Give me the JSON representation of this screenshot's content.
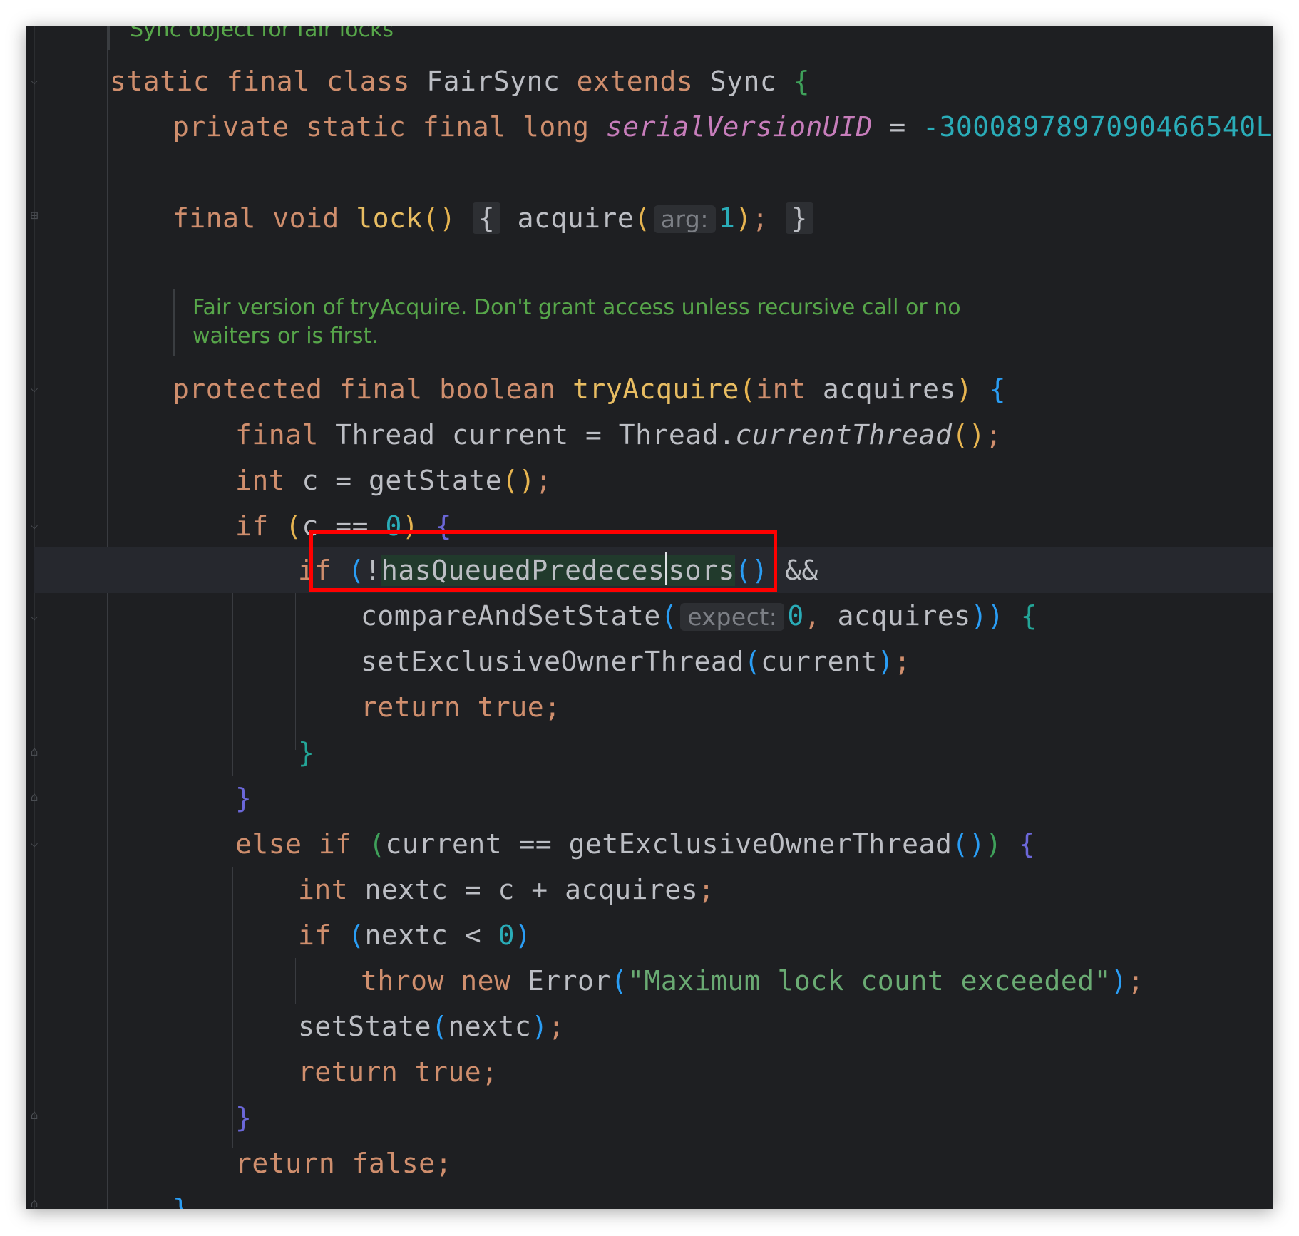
{
  "colors": {
    "background": "#1e1f22",
    "keyword": "#cf8e6d",
    "method_call": "#56a8f5",
    "method_declaration": "#e8bd62",
    "number": "#2aacb8",
    "string": "#6aab73",
    "static_field": "#c77dbb",
    "comment": "#57a64a",
    "highlight_box": "#ff0000"
  },
  "doc_comments": {
    "top": "Sync object for fair locks",
    "try_acquire_line1": "Fair version of tryAcquire. Don't grant access unless recursive call or no",
    "try_acquire_line2": "waiters or is first."
  },
  "inlay_hints": {
    "arg": "arg:",
    "expect": "expect:"
  },
  "code": {
    "l1": {
      "kw1": "static",
      "kw2": "final",
      "kw3": "class",
      "cls": "FairSync",
      "kw4": "extends",
      "parent": "Sync",
      "brace": "{"
    },
    "l2": {
      "kw1": "private",
      "kw2": "static",
      "kw3": "final",
      "kw4": "long",
      "field": "serialVersionUID",
      "eq": " = ",
      "value": "-3000897897090466540L",
      "semi": ";"
    },
    "l3": {
      "kw1": "final",
      "kw2": "void",
      "name": "lock",
      "parens": "()",
      "lbrace": "{",
      "call": "acquire",
      "lp": "(",
      "arg": "1",
      "rp": ")",
      "semi": ";",
      "rbrace": "}"
    },
    "l4": {
      "kw1": "protected",
      "kw2": "final",
      "kw3": "boolean",
      "name": "tryAcquire",
      "lp": "(",
      "ptype": "int",
      "pname": "acquires",
      "rp": ")",
      "brace": "{"
    },
    "l5": {
      "kw": "final",
      "type": "Thread",
      "var": "current",
      "eq": " = ",
      "cls": "Thread",
      "dot": ".",
      "call": "currentThread",
      "parens": "()",
      "semi": ";"
    },
    "l6": {
      "kw": "int",
      "rest": "c = ",
      "call": "getState",
      "parens": "()",
      "semi": ";"
    },
    "l7": {
      "kw": "if",
      "lp": "(",
      "cond": "c == ",
      "zero": "0",
      "rp": ")",
      "brace": "{"
    },
    "l8": {
      "kw": "if",
      "lp": "(",
      "bang": "!",
      "call_a": "hasQueuedPredeces",
      "call_b": "sors",
      "parens": "()",
      "op": "&&"
    },
    "l9": {
      "call": "compareAndSetState",
      "lp": "(",
      "zero": "0",
      "comma": ", ",
      "arg": "acquires",
      "rp": ")",
      "rp2": ")",
      "brace": "{"
    },
    "l10": {
      "call": "setExclusiveOwnerThread",
      "lp": "(",
      "arg": "current",
      "rp": ")",
      "semi": ";"
    },
    "l11": {
      "kw1": "return",
      "kw2": "true",
      "semi": ";"
    },
    "l12": {
      "brace": "}"
    },
    "l13": {
      "brace": "}"
    },
    "l14": {
      "kw1": "else",
      "kw2": "if",
      "lp": "(",
      "var": "current",
      "op": " == ",
      "call": "getExclusiveOwnerThread",
      "parens": "()",
      "rp": ")",
      "brace": "{"
    },
    "l15": {
      "kw": "int",
      "rest": "nextc = c + acquires",
      "semi": ";"
    },
    "l16": {
      "kw": "if",
      "lp": "(",
      "cond": "nextc < ",
      "zero": "0",
      "rp": ")"
    },
    "l17": {
      "kw1": "throw",
      "kw2": "new",
      "cls": "Error",
      "lp": "(",
      "str": "\"Maximum lock count exceeded\"",
      "rp": ")",
      "semi": ";"
    },
    "l18": {
      "call": "setState",
      "lp": "(",
      "arg": "nextc",
      "rp": ")",
      "semi": ";"
    },
    "l19": {
      "kw1": "return",
      "kw2": "true",
      "semi": ";"
    },
    "l20": {
      "brace": "}"
    },
    "l21": {
      "kw1": "return",
      "kw2": "false",
      "semi": ";"
    },
    "l22": {
      "brace": "}"
    }
  }
}
